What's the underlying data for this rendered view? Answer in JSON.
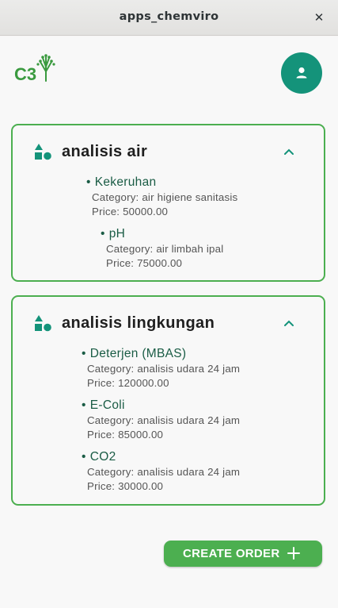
{
  "window": {
    "title": "apps_chemviro",
    "close_glyph": "✕"
  },
  "header": {
    "logo_text": "C3",
    "avatar_icon": "person-icon"
  },
  "categories": [
    {
      "title": "analisis air",
      "icon": "shapes-icon",
      "expanded": true,
      "items": [
        {
          "name": "Kekeruhan",
          "category": "Category: air higiene sanitasis",
          "price": "Price: 50000.00"
        },
        {
          "name": "pH",
          "category": "Category: air limbah ipal",
          "price": "Price: 75000.00"
        }
      ]
    },
    {
      "title": "analisis lingkungan",
      "icon": "shapes-icon",
      "expanded": true,
      "items": [
        {
          "name": "Deterjen (MBAS)",
          "category": "Category: analisis udara 24 jam",
          "price": "Price: 120000.00"
        },
        {
          "name": "E-Coli",
          "category": "Category: analisis udara 24 jam",
          "price": "Price: 85000.00"
        },
        {
          "name": "CO2",
          "category": "Category: analisis udara 24 jam",
          "price": "Price: 30000.00"
        }
      ]
    }
  ],
  "actions": {
    "create_order_label": "CREATE ORDER",
    "create_order_icon": "plus-icon"
  },
  "colors": {
    "accent_green": "#4caf50",
    "teal": "#14937a",
    "item_text": "#1a5c45"
  }
}
